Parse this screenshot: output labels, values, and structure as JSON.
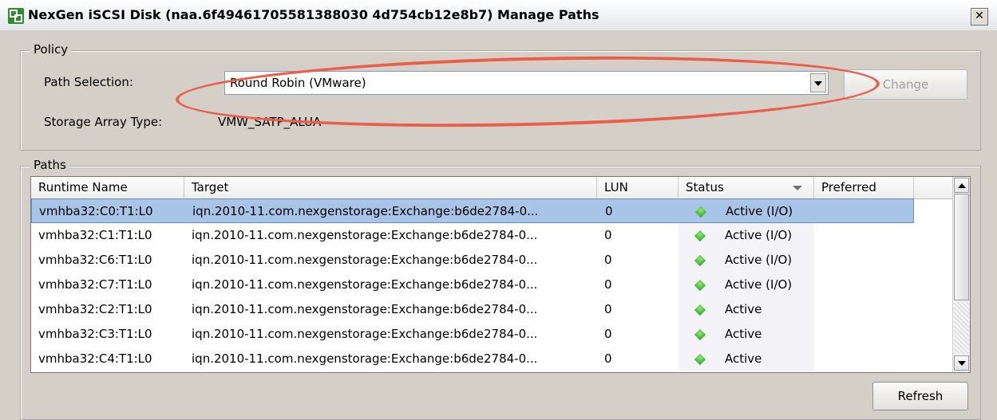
{
  "window": {
    "title": "NexGen iSCSI Disk (naa.6f49461705581388030 4d754cb12e8b7) Manage Paths",
    "close_glyph": "✕"
  },
  "policy": {
    "legend": "Policy",
    "path_selection_label": "Path Selection:",
    "path_selection_value": "Round Robin (VMware)",
    "change_button": "Change",
    "storage_array_type_label": "Storage Array Type:",
    "storage_array_type_value": "VMW_SATP_ALUA",
    "highlight_color": "#e8604a"
  },
  "paths": {
    "legend": "Paths",
    "columns": [
      "Runtime Name",
      "Target",
      "LUN",
      "Status",
      "Preferred"
    ],
    "rows": [
      {
        "runtime": "vmhba32:C0:T1:L0",
        "target": "iqn.2010-11.com.nexgenstorage:Exchange:b6de2784-0...",
        "lun": "0",
        "status": "Active (I/O)",
        "selected": true
      },
      {
        "runtime": "vmhba32:C1:T1:L0",
        "target": "iqn.2010-11.com.nexgenstorage:Exchange:b6de2784-0...",
        "lun": "0",
        "status": "Active (I/O)"
      },
      {
        "runtime": "vmhba32:C6:T1:L0",
        "target": "iqn.2010-11.com.nexgenstorage:Exchange:b6de2784-0...",
        "lun": "0",
        "status": "Active (I/O)"
      },
      {
        "runtime": "vmhba32:C7:T1:L0",
        "target": "iqn.2010-11.com.nexgenstorage:Exchange:b6de2784-0...",
        "lun": "0",
        "status": "Active (I/O)"
      },
      {
        "runtime": "vmhba32:C2:T1:L0",
        "target": "iqn.2010-11.com.nexgenstorage:Exchange:b6de2784-0...",
        "lun": "0",
        "status": "Active"
      },
      {
        "runtime": "vmhba32:C3:T1:L0",
        "target": "iqn.2010-11.com.nexgenstorage:Exchange:b6de2784-0...",
        "lun": "0",
        "status": "Active"
      },
      {
        "runtime": "vmhba32:C4:T1:L0",
        "target": "iqn.2010-11.com.nexgenstorage:Exchange:b6de2784-0...",
        "lun": "0",
        "status": "Active"
      }
    ],
    "refresh_button": "Refresh",
    "status_color": "#21a12a",
    "selected_row_color": "#a8c4e6"
  }
}
